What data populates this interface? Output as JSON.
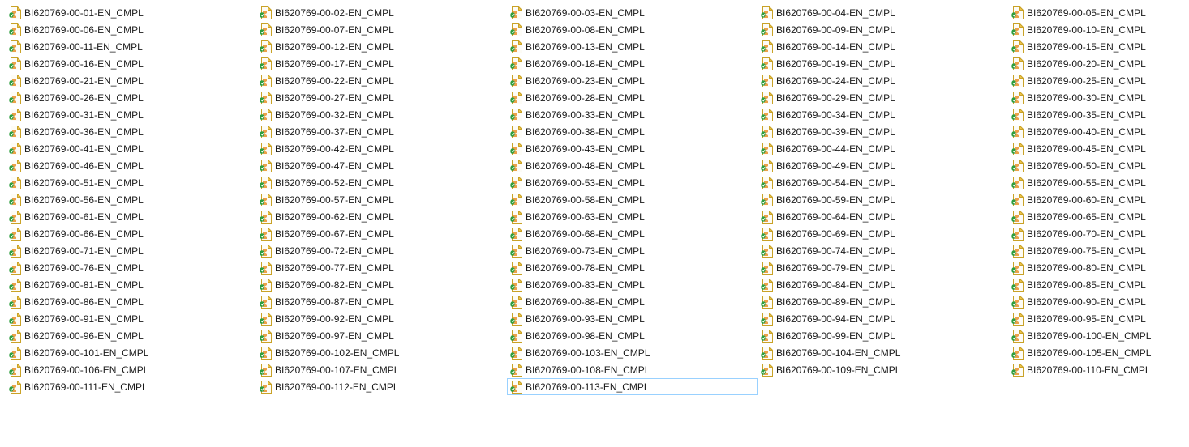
{
  "window": {
    "view": "list",
    "selected_file": "BI620769-00-113-EN_CMPL"
  },
  "icon": {
    "name": "map-document-icon",
    "colors": {
      "page": "#fdfcf6",
      "border": "#c9a227",
      "folded_corner": "#f0c44c",
      "accent_green": "#2e9e3e",
      "accent_orange": "#e8912a"
    }
  },
  "files": [
    "BI620769-00-01-EN_CMPL",
    "BI620769-00-02-EN_CMPL",
    "BI620769-00-03-EN_CMPL",
    "BI620769-00-04-EN_CMPL",
    "BI620769-00-05-EN_CMPL",
    "BI620769-00-06-EN_CMPL",
    "BI620769-00-07-EN_CMPL",
    "BI620769-00-08-EN_CMPL",
    "BI620769-00-09-EN_CMPL",
    "BI620769-00-10-EN_CMPL",
    "BI620769-00-11-EN_CMPL",
    "BI620769-00-12-EN_CMPL",
    "BI620769-00-13-EN_CMPL",
    "BI620769-00-14-EN_CMPL",
    "BI620769-00-15-EN_CMPL",
    "BI620769-00-16-EN_CMPL",
    "BI620769-00-17-EN_CMPL",
    "BI620769-00-18-EN_CMPL",
    "BI620769-00-19-EN_CMPL",
    "BI620769-00-20-EN_CMPL",
    "BI620769-00-21-EN_CMPL",
    "BI620769-00-22-EN_CMPL",
    "BI620769-00-23-EN_CMPL",
    "BI620769-00-24-EN_CMPL",
    "BI620769-00-25-EN_CMPL",
    "BI620769-00-26-EN_CMPL",
    "BI620769-00-27-EN_CMPL",
    "BI620769-00-28-EN_CMPL",
    "BI620769-00-29-EN_CMPL",
    "BI620769-00-30-EN_CMPL",
    "BI620769-00-31-EN_CMPL",
    "BI620769-00-32-EN_CMPL",
    "BI620769-00-33-EN_CMPL",
    "BI620769-00-34-EN_CMPL",
    "BI620769-00-35-EN_CMPL",
    "BI620769-00-36-EN_CMPL",
    "BI620769-00-37-EN_CMPL",
    "BI620769-00-38-EN_CMPL",
    "BI620769-00-39-EN_CMPL",
    "BI620769-00-40-EN_CMPL",
    "BI620769-00-41-EN_CMPL",
    "BI620769-00-42-EN_CMPL",
    "BI620769-00-43-EN_CMPL",
    "BI620769-00-44-EN_CMPL",
    "BI620769-00-45-EN_CMPL",
    "BI620769-00-46-EN_CMPL",
    "BI620769-00-47-EN_CMPL",
    "BI620769-00-48-EN_CMPL",
    "BI620769-00-49-EN_CMPL",
    "BI620769-00-50-EN_CMPL",
    "BI620769-00-51-EN_CMPL",
    "BI620769-00-52-EN_CMPL",
    "BI620769-00-53-EN_CMPL",
    "BI620769-00-54-EN_CMPL",
    "BI620769-00-55-EN_CMPL",
    "BI620769-00-56-EN_CMPL",
    "BI620769-00-57-EN_CMPL",
    "BI620769-00-58-EN_CMPL",
    "BI620769-00-59-EN_CMPL",
    "BI620769-00-60-EN_CMPL",
    "BI620769-00-61-EN_CMPL",
    "BI620769-00-62-EN_CMPL",
    "BI620769-00-63-EN_CMPL",
    "BI620769-00-64-EN_CMPL",
    "BI620769-00-65-EN_CMPL",
    "BI620769-00-66-EN_CMPL",
    "BI620769-00-67-EN_CMPL",
    "BI620769-00-68-EN_CMPL",
    "BI620769-00-69-EN_CMPL",
    "BI620769-00-70-EN_CMPL",
    "BI620769-00-71-EN_CMPL",
    "BI620769-00-72-EN_CMPL",
    "BI620769-00-73-EN_CMPL",
    "BI620769-00-74-EN_CMPL",
    "BI620769-00-75-EN_CMPL",
    "BI620769-00-76-EN_CMPL",
    "BI620769-00-77-EN_CMPL",
    "BI620769-00-78-EN_CMPL",
    "BI620769-00-79-EN_CMPL",
    "BI620769-00-80-EN_CMPL",
    "BI620769-00-81-EN_CMPL",
    "BI620769-00-82-EN_CMPL",
    "BI620769-00-83-EN_CMPL",
    "BI620769-00-84-EN_CMPL",
    "BI620769-00-85-EN_CMPL",
    "BI620769-00-86-EN_CMPL",
    "BI620769-00-87-EN_CMPL",
    "BI620769-00-88-EN_CMPL",
    "BI620769-00-89-EN_CMPL",
    "BI620769-00-90-EN_CMPL",
    "BI620769-00-91-EN_CMPL",
    "BI620769-00-92-EN_CMPL",
    "BI620769-00-93-EN_CMPL",
    "BI620769-00-94-EN_CMPL",
    "BI620769-00-95-EN_CMPL",
    "BI620769-00-96-EN_CMPL",
    "BI620769-00-97-EN_CMPL",
    "BI620769-00-98-EN_CMPL",
    "BI620769-00-99-EN_CMPL",
    "BI620769-00-100-EN_CMPL",
    "BI620769-00-101-EN_CMPL",
    "BI620769-00-102-EN_CMPL",
    "BI620769-00-103-EN_CMPL",
    "BI620769-00-104-EN_CMPL",
    "BI620769-00-105-EN_CMPL",
    "BI620769-00-106-EN_CMPL",
    "BI620769-00-107-EN_CMPL",
    "BI620769-00-108-EN_CMPL",
    "BI620769-00-109-EN_CMPL",
    "BI620769-00-110-EN_CMPL",
    "BI620769-00-111-EN_CMPL",
    "BI620769-00-112-EN_CMPL",
    "BI620769-00-113-EN_CMPL"
  ]
}
